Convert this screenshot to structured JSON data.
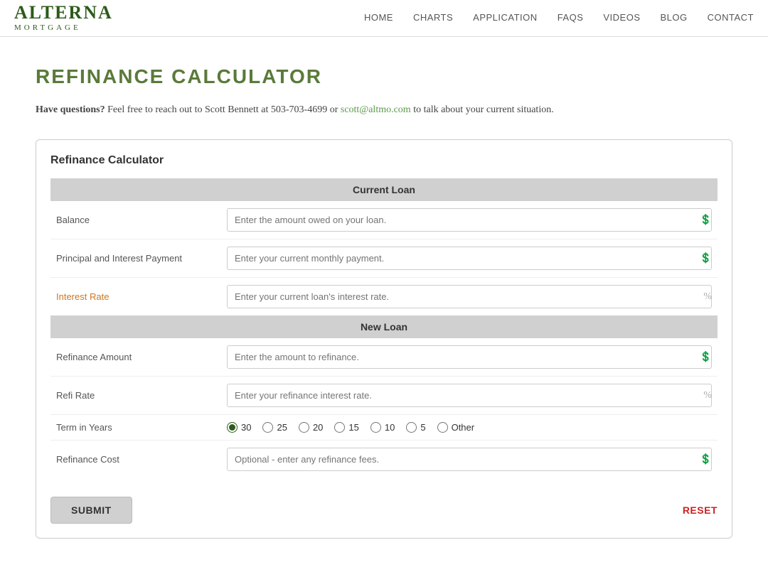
{
  "logo": {
    "main": "ALTERNA",
    "sub": "MORTGAGE"
  },
  "nav": {
    "items": [
      {
        "label": "HOME",
        "href": "#"
      },
      {
        "label": "CHARTS",
        "href": "#"
      },
      {
        "label": "APPLICATION",
        "href": "#"
      },
      {
        "label": "FAQS",
        "href": "#"
      },
      {
        "label": "VIDEOS",
        "href": "#"
      },
      {
        "label": "BLOG",
        "href": "#"
      },
      {
        "label": "CONTACT",
        "href": "#"
      }
    ]
  },
  "page": {
    "title": "REFINANCE CALCULATOR",
    "intro_bold": "Have questions?",
    "intro_text": " Feel free to reach out to Scott Bennett at 503-703-4699 or ",
    "email_label": "scott@altmo.com",
    "intro_end": " to talk about your current situation."
  },
  "calculator": {
    "card_title": "Refinance Calculator",
    "current_loan_header": "Current Loan",
    "new_loan_header": "New Loan",
    "fields": {
      "balance_label": "Balance",
      "balance_placeholder": "Enter the amount owed on your loan.",
      "principal_label": "Principal and Interest Payment",
      "principal_placeholder": "Enter your current monthly payment.",
      "interest_label": "Interest Rate",
      "interest_placeholder": "Enter your current loan's interest rate.",
      "refi_amount_label": "Refinance Amount",
      "refi_amount_placeholder": "Enter the amount to refinance.",
      "refi_rate_label": "Refi Rate",
      "refi_rate_placeholder": "Enter your refinance interest rate.",
      "term_label": "Term in Years",
      "refi_cost_label": "Refinance Cost",
      "refi_cost_placeholder": "Optional - enter any refinance fees."
    },
    "term_options": [
      "30",
      "25",
      "20",
      "15",
      "10",
      "5",
      "Other"
    ],
    "term_default": "30",
    "submit_label": "SUBMIT",
    "reset_label": "RESET"
  }
}
